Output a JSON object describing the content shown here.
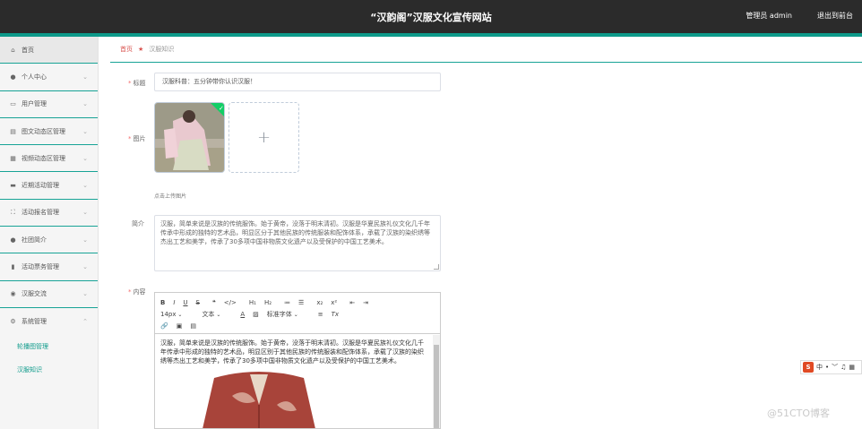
{
  "header": {
    "title": "“汉韵阁”汉服文化宣传网站",
    "user": "管理员 admin",
    "logout": "退出到前台"
  },
  "sidebar": {
    "items": [
      {
        "label": "首页",
        "icon": "home-icon"
      },
      {
        "label": "个人中心",
        "icon": "user-icon"
      },
      {
        "label": "用户管理",
        "icon": "message-icon"
      },
      {
        "label": "图文动态区管理",
        "icon": "document-icon"
      },
      {
        "label": "视频动态区管理",
        "icon": "grid-icon"
      },
      {
        "label": "近期活动管理",
        "icon": "flag-icon"
      },
      {
        "label": "活动报名管理",
        "icon": "crop-icon"
      },
      {
        "label": "社团简介",
        "icon": "user-group-icon"
      },
      {
        "label": "活动票务管理",
        "icon": "chart-icon"
      },
      {
        "label": "汉服交流",
        "icon": "target-icon"
      },
      {
        "label": "系统管理",
        "icon": "settings-icon"
      }
    ],
    "subitems": [
      {
        "label": "轮播图管理"
      },
      {
        "label": "汉服知识"
      }
    ]
  },
  "breadcrumb": {
    "home": "首页",
    "current": "汉服知识"
  },
  "form": {
    "title_label": "标题",
    "title_value": "汉服科普：五分钟带你认识汉服！",
    "image_label": "图片",
    "upload_hint": "点击上传图片",
    "intro_label": "简介",
    "intro_value": "汉服，简单来说是汉族的传统服饰。始于黄帝，没落于明末清初。汉服是华夏民族礼仪文化几千年传承中形成的独特的艺术品，明显区分于其他民族的传统服装和配饰体系，承载了汉族的染织绣等杰出工艺和美学，传承了30多项中国非物质文化遗产以及受保护的中国工艺美术。",
    "content_label": "内容",
    "content_value": "汉服，简单来说是汉族的传统服饰。始于黄帝，没落于明末清初。汉服是华夏民族礼仪文化几千年传承中形成的独特的艺术品，明显区别于其他民族的传统服装和配饰体系，承载了汉族的染织绣等杰出工艺和美学，传承了30多项中国非物质文化遗产以及受保护的中国工艺美术。"
  },
  "editor": {
    "row1": [
      "B",
      "I",
      "U",
      "S",
      "❝",
      "</>",
      "H₁",
      "H₂",
      "≔",
      "☰",
      "x₂",
      "x²",
      "⇤",
      "⇥"
    ],
    "font_size": "14px",
    "header_select": "文本",
    "color_a": "A",
    "font_select": "标准字体",
    "align": "≡",
    "clear": "Tx"
  },
  "ime": {
    "label": "中",
    "items": [
      "中",
      "•",
      "﹀",
      "♫",
      "▦"
    ]
  },
  "watermark": "@51CTO博客"
}
